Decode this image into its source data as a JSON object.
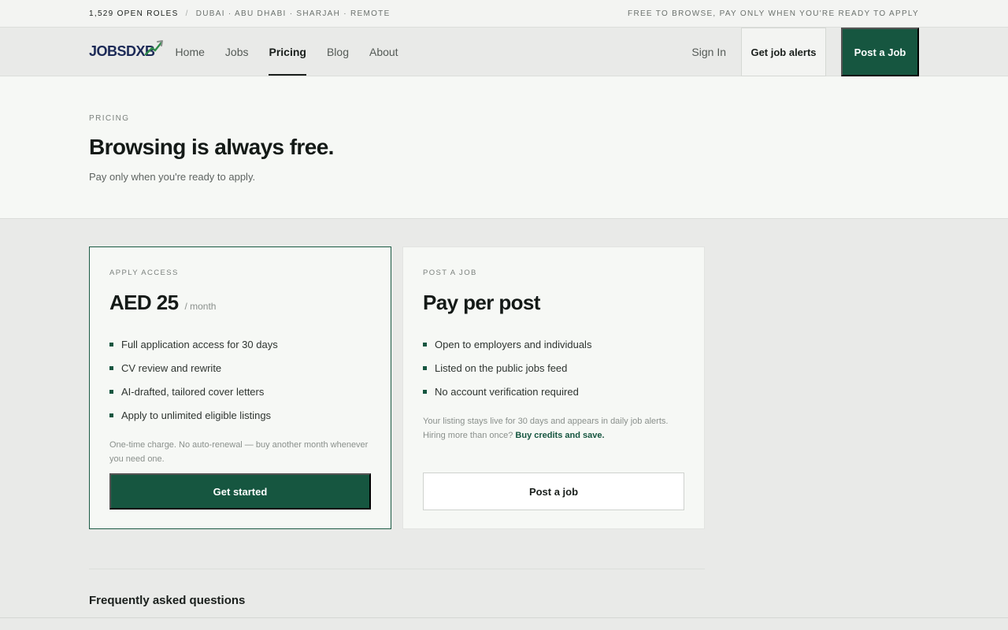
{
  "topbar": {
    "open_roles": "1,529 open roles",
    "separator": "/",
    "locations": "Dubai · Abu Dhabi · Sharjah · Remote",
    "tagline": "Free to browse, pay only when you're ready to apply"
  },
  "nav": {
    "logo_text_a": "JOBS ",
    "logo_text_b": "DXB",
    "links": [
      {
        "label": "Home"
      },
      {
        "label": "Jobs"
      },
      {
        "label": "Pricing"
      },
      {
        "label": "Blog"
      },
      {
        "label": "About"
      }
    ],
    "active": "Pricing",
    "sign_in": "Sign In",
    "alerts_button": "Get job alerts",
    "post_button": "Post a Job"
  },
  "hero": {
    "eyebrow": "Pricing",
    "title": "Browsing is always free.",
    "subtitle": "Pay only when you're ready to apply."
  },
  "cards": {
    "apply": {
      "label": "Apply access",
      "amount": "AED 25",
      "period": "/ month",
      "features": [
        "Full application access for 30 days",
        "CV review and rewrite",
        "AI-drafted, tailored cover letters",
        "Apply to unlimited eligible listings"
      ],
      "note": "One-time charge. No auto-renewal — buy another month whenever you need one.",
      "cta": "Get started"
    },
    "post": {
      "label": "Post a job",
      "title": "Pay per post",
      "features": [
        "Open to employers and individuals",
        "Listed on the public jobs feed",
        "No account verification required"
      ],
      "note": "Your listing stays live for 30 days and appears in daily job alerts. Hiring more than once?",
      "note_link": "Buy credits and save.",
      "cta": "Post a job"
    }
  },
  "faq": {
    "title": "Frequently asked questions"
  },
  "colors": {
    "brand_green": "#165640",
    "logo_navy": "#1c2a57",
    "page_bg": "#e9eae8",
    "card_bg": "#f6f8f5"
  }
}
